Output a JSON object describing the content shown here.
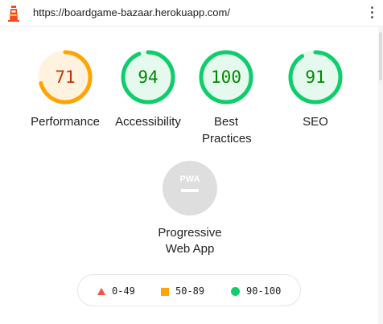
{
  "browser": {
    "url": "https://boardgame-bazaar.herokuapp.com/",
    "logo_icon": "lighthouse-icon",
    "menu_icon": "kebab-menu-icon"
  },
  "colors": {
    "fail": "#ff4e42",
    "average": "#ffa400",
    "pass": "#0cce6b",
    "average_text": "#c33300",
    "pass_text": "#008800",
    "average_bg": "#fff3e0",
    "pass_bg": "#e6f9ee",
    "pwa_gray": "#dedede"
  },
  "categories": [
    {
      "id": "performance",
      "score": 71,
      "label": "Performance",
      "rating": "average"
    },
    {
      "id": "accessibility",
      "score": 94,
      "label": "Accessibility",
      "rating": "pass"
    },
    {
      "id": "best-practices",
      "score": 100,
      "label": "Best Practices",
      "rating": "pass"
    },
    {
      "id": "seo",
      "score": 91,
      "label": "SEO",
      "rating": "pass"
    }
  ],
  "pwa": {
    "badge_text": "PWA",
    "label": "Progressive Web App",
    "icon": "pwa-badge-icon"
  },
  "legend": [
    {
      "shape": "triangle",
      "range": "0-49"
    },
    {
      "shape": "square",
      "range": "50-89"
    },
    {
      "shape": "circle",
      "range": "90-100"
    }
  ]
}
